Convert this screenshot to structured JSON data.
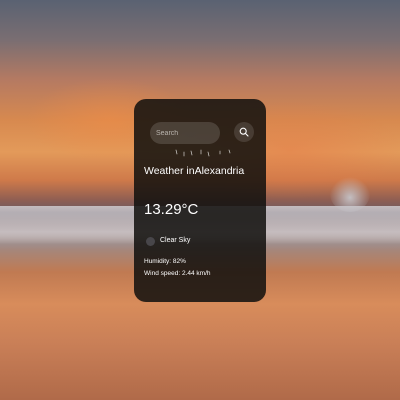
{
  "search": {
    "placeholder": "Search",
    "button_icon": "search-icon"
  },
  "weather": {
    "title_prefix": "Weather in",
    "city": "Alexandria",
    "temperature": "13.29°C",
    "condition": "Clear Sky",
    "condition_icon": "weather-condition-icon",
    "humidity_label": "Humidity:",
    "humidity_value": "82%",
    "wind_label": "Wind speed:",
    "wind_value": "2.44 km/h"
  },
  "colors": {
    "card_background": "#121010",
    "text": "#ffffff"
  }
}
